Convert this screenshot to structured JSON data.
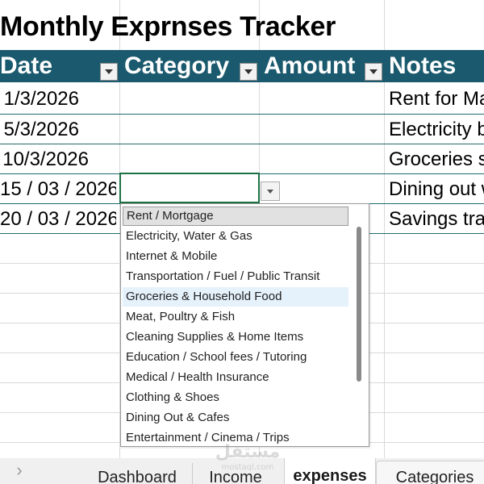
{
  "sheet": {
    "title": "Monthly Exprnses Tracker"
  },
  "headers": {
    "date": "Date",
    "category": "Category",
    "amount": "Amount",
    "notes": "Notes"
  },
  "rows": [
    {
      "date": "1/3/2026",
      "category": "",
      "amount": "",
      "notes": "Rent for Ma"
    },
    {
      "date": "5/3/2026",
      "category": "",
      "amount": "",
      "notes": "Electricity b"
    },
    {
      "date": "10/3/2026",
      "category": "",
      "amount": "",
      "notes": "Groceries s"
    },
    {
      "date": "15 / 03 / 2026",
      "category": "",
      "amount": "",
      "notes": "Dining out w"
    },
    {
      "date": "20 / 03 / 2026",
      "category": "",
      "amount": "",
      "notes": "Savings tra"
    }
  ],
  "dropdown": {
    "options": [
      "Rent / Mortgage",
      "Electricity, Water & Gas",
      "Internet & Mobile",
      "Transportation / Fuel / Public Transit",
      "Groceries & Household Food",
      "Meat, Poultry & Fish",
      "Cleaning Supplies & Home Items",
      "Education / School fees / Tutoring",
      "Medical / Health Insurance",
      "Clothing & Shoes",
      "Dining Out & Cafes",
      "Entertainment / Cinema / Trips"
    ],
    "selected_index": 0,
    "hover_index": 4
  },
  "tabs": {
    "scroll_arrow": "›",
    "items": [
      "Dashboard",
      "Income",
      "expenses",
      "Categories"
    ],
    "active": "expenses"
  },
  "watermark": {
    "arabic": "مستقل",
    "latin": "mostaql.com"
  },
  "colors": {
    "header_bg": "#1b5a6e",
    "active_cell_border": "#1e7145",
    "hover_bg": "#e5f1fb"
  }
}
